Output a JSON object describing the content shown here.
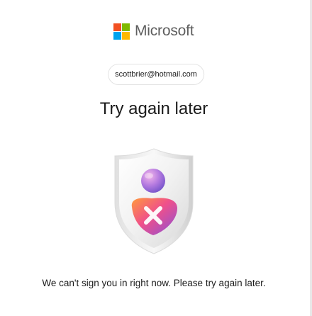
{
  "brand": {
    "name": "Microsoft",
    "logo_colors": [
      "#f25022",
      "#7fba00",
      "#00a4ef",
      "#ffb900"
    ]
  },
  "identity": {
    "email": "scottbrier@hotmail.com"
  },
  "page": {
    "title": "Try again later",
    "illustration_icon": "shield-user-error-icon",
    "message": "We can't sign you in right now. Please try again later."
  }
}
